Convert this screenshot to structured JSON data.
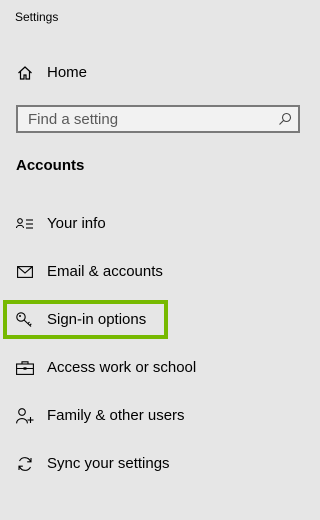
{
  "window": {
    "title": "Settings"
  },
  "nav": {
    "home_label": "Home"
  },
  "search": {
    "placeholder": "Find a setting",
    "value": ""
  },
  "section": {
    "heading": "Accounts"
  },
  "menu": {
    "items": [
      {
        "label": "Your info",
        "icon": "person-card-icon"
      },
      {
        "label": "Email & accounts",
        "icon": "mail-icon"
      },
      {
        "label": "Sign-in options",
        "icon": "key-icon"
      },
      {
        "label": "Access work or school",
        "icon": "briefcase-icon"
      },
      {
        "label": "Family & other users",
        "icon": "person-add-icon"
      },
      {
        "label": "Sync your settings",
        "icon": "sync-icon"
      }
    ]
  },
  "colors": {
    "background": "#e6e6e6",
    "highlight": "#76b900",
    "search_border": "#7a7a7a"
  }
}
